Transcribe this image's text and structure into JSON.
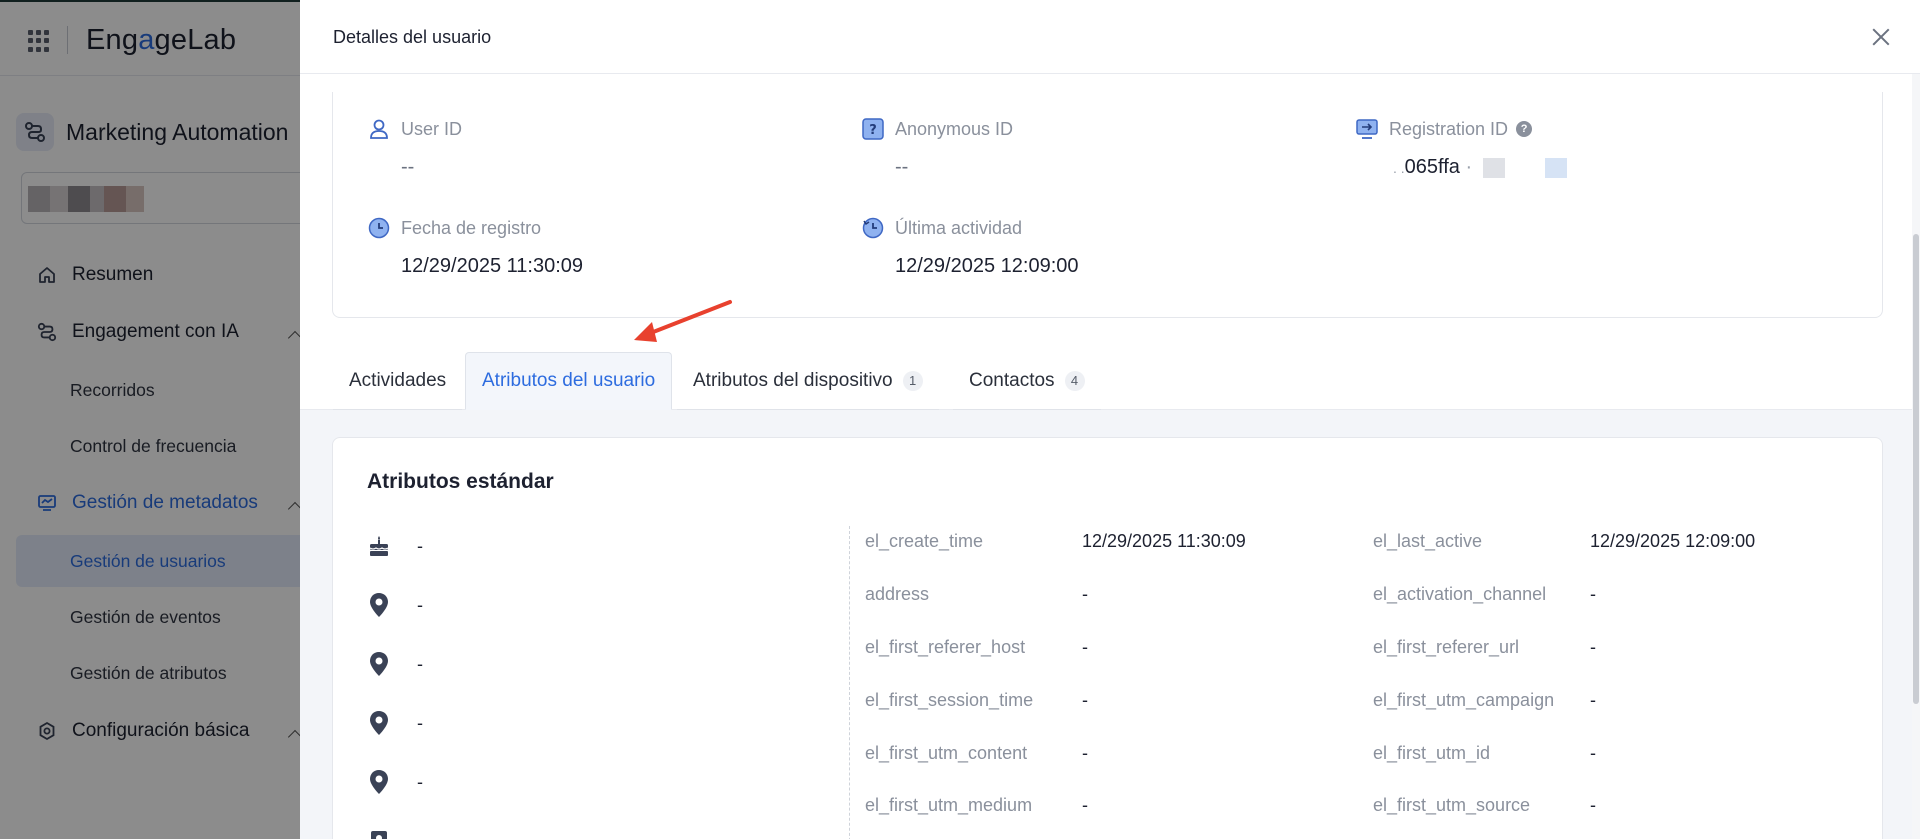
{
  "app": {
    "logo_pre": "Eng",
    "logo_accent": "a",
    "logo_post": "geLab",
    "module_title": "Marketing Automation"
  },
  "sidebar": {
    "summary": "Resumen",
    "ai_engagement": "Engagement con IA",
    "journeys": "Recorridos",
    "frequency": "Control de frecuencia",
    "metadata": "Gestión de metadatos",
    "users": "Gestión de usuarios",
    "events": "Gestión de eventos",
    "attributes": "Gestión de atributos",
    "basic_config": "Configuración básica"
  },
  "drawer": {
    "title": "Detalles del usuario"
  },
  "identity": {
    "user_id_label": "User ID",
    "user_id_value": "--",
    "anon_id_label": "Anonymous ID",
    "anon_id_value": "--",
    "reg_id_label": "Registration ID",
    "reg_id_value": "065ffa",
    "reg_date_label": "Fecha de registro",
    "reg_date_value": "12/29/2025 11:30:09",
    "last_activity_label": "Última actividad",
    "last_activity_value": "12/29/2025 12:09:00"
  },
  "tabs": [
    {
      "label": "Actividades",
      "count": null
    },
    {
      "label": "Atributos del usuario",
      "count": null
    },
    {
      "label": "Atributos del dispositivo",
      "count": "1"
    },
    {
      "label": "Contactos",
      "count": "4"
    }
  ],
  "standard": {
    "title": "Atributos estándar",
    "left_values": [
      "-",
      "-",
      "-",
      "-",
      "-"
    ],
    "mid": [
      {
        "key": "el_create_time",
        "value": "12/29/2025 11:30:09"
      },
      {
        "key": "address",
        "value": "-"
      },
      {
        "key": "el_first_referer_host",
        "value": "-"
      },
      {
        "key": "el_first_session_time",
        "value": "-"
      },
      {
        "key": "el_first_utm_content",
        "value": "-"
      },
      {
        "key": "el_first_utm_medium",
        "value": "-"
      }
    ],
    "right": [
      {
        "key": "el_last_active",
        "value": "12/29/2025 12:09:00"
      },
      {
        "key": "el_activation_channel",
        "value": "-"
      },
      {
        "key": "el_first_referer_url",
        "value": "-"
      },
      {
        "key": "el_first_utm_campaign",
        "value": "-"
      },
      {
        "key": "el_first_utm_id",
        "value": "-"
      },
      {
        "key": "el_first_utm_source",
        "value": "-"
      }
    ]
  },
  "colors": {
    "accent": "#2d6cdf",
    "annotation_arrow": "#e8412e"
  }
}
